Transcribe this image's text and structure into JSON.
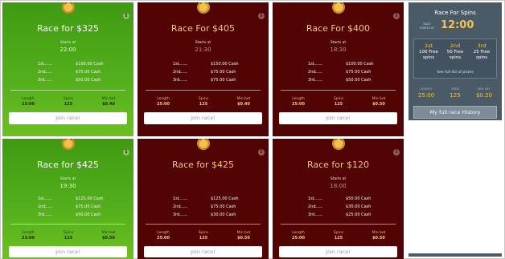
{
  "cards": [
    {
      "title": "Race for $325",
      "starts_label": "Starts at",
      "starts_time": "22:00",
      "prizes": [
        {
          "pos": "1st",
          "amount": "$100.00 Cash"
        },
        {
          "pos": "2nd",
          "amount": "$75.00 Cash"
        },
        {
          "pos": "3rd",
          "amount": "$50.00 Cash"
        }
      ],
      "stats": {
        "length_label": "Length",
        "length": "25:00",
        "spins_label": "Spins",
        "spins": "125",
        "minbet_label": "Min bet",
        "minbet": "$0.40"
      },
      "join": "Join race!"
    },
    {
      "title": "Race For $405",
      "starts_label": "Starts at",
      "starts_time": "21:30",
      "prizes": [
        {
          "pos": "1st",
          "amount": "$150.00 Cash"
        },
        {
          "pos": "2nd",
          "amount": "$75.00 Cash"
        },
        {
          "pos": "3rd",
          "amount": "$75.00 Cash"
        }
      ],
      "stats": {
        "length_label": "Length",
        "length": "25:00",
        "spins_label": "Spins",
        "spins": "125",
        "minbet_label": "Min bet",
        "minbet": "$0.40"
      },
      "join": "Join race!"
    },
    {
      "title": "Race For $400",
      "starts_label": "Starts at",
      "starts_time": "18:30",
      "prizes": [
        {
          "pos": "1st",
          "amount": "$100.00 Cash"
        },
        {
          "pos": "2nd",
          "amount": "$75.00 Cash"
        },
        {
          "pos": "3rd",
          "amount": "$50.00 Cash"
        }
      ],
      "stats": {
        "length_label": "Length",
        "length": "25:00",
        "spins_label": "Spins",
        "spins": "125",
        "minbet_label": "Min bet",
        "minbet": "$0.50"
      },
      "join": "Join race!"
    },
    {
      "title": "Race for $425",
      "starts_label": "Starts at",
      "starts_time": "19:30",
      "prizes": [
        {
          "pos": "1st",
          "amount": "$125.00 Cash"
        },
        {
          "pos": "2nd",
          "amount": "$75.00 Cash"
        },
        {
          "pos": "3rd",
          "amount": "$50.00 Cash"
        }
      ],
      "stats": {
        "length_label": "Length",
        "length": "25:00",
        "spins_label": "Spins",
        "spins": "125",
        "minbet_label": "Min bet",
        "minbet": "$0.50"
      },
      "join": "Join race!"
    },
    {
      "title": "Race for $425",
      "starts_label": "",
      "starts_time": "",
      "prizes": [
        {
          "pos": "1st",
          "amount": "$125.00 Cash"
        },
        {
          "pos": "2nd",
          "amount": "$75.00 Cash"
        },
        {
          "pos": "3rd",
          "amount": "$30.00 Cash"
        }
      ],
      "stats": {
        "length_label": "Length",
        "length": "25:00",
        "spins_label": "Spins",
        "spins": "125",
        "minbet_label": "Min bet",
        "minbet": "$0.50"
      },
      "join": "Join race!"
    },
    {
      "title": "Race for $120",
      "starts_label": "Starts at",
      "starts_time": "18:00",
      "prizes": [
        {
          "pos": "1st",
          "amount": "$50.00 Cash"
        },
        {
          "pos": "2nd",
          "amount": "$30.00 Cash"
        },
        {
          "pos": "3rd",
          "amount": "$25.00 Cash"
        }
      ],
      "stats": {
        "length_label": "Length",
        "length": "25:00",
        "spins_label": "Spins",
        "spins": "125",
        "minbet_label": "Min bet",
        "minbet": "$0.50"
      },
      "join": "Join race!"
    }
  ],
  "sidebar": {
    "title": "Race For Spins",
    "race_starts_label": "RACE STARTS AT",
    "race_starts_time": "12:00",
    "prizes": [
      {
        "rank": "1st",
        "line1": "100 Free",
        "line2": "spins"
      },
      {
        "rank": "2nd",
        "line1": "50 Free",
        "line2": "spins"
      },
      {
        "rank": "3rd",
        "line1": "25 Free",
        "line2": "spins"
      }
    ],
    "see_full": "See full list of prizes",
    "stats": [
      {
        "label": "LENGTH",
        "value": "25:00"
      },
      {
        "label": "SPINS",
        "value": "125"
      },
      {
        "label": "MIN. BET",
        "value": "$0.20"
      }
    ],
    "history_button": "My full race History"
  },
  "colors": {
    "green_card": "#55b01c",
    "dark_card": "#520404",
    "gold_text": "#f4c57c",
    "sidebar_bg": "#4a5a66",
    "sidebar_gold": "#f2c24b"
  },
  "icons": {
    "medal": "medal-icon",
    "info": "info-icon"
  }
}
